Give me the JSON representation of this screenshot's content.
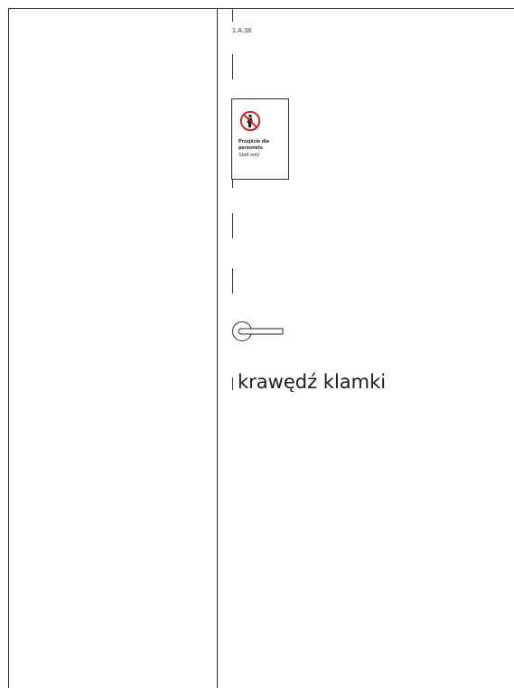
{
  "room_code": "1.A.38",
  "sign": {
    "icon": "no-entry-person-icon",
    "title": "Przejście dla personelu",
    "subtitle": "Staff only",
    "accent_color": "#d7191c"
  },
  "handle": {
    "icon": "door-handle-icon"
  },
  "caption": "krawędź klamki"
}
